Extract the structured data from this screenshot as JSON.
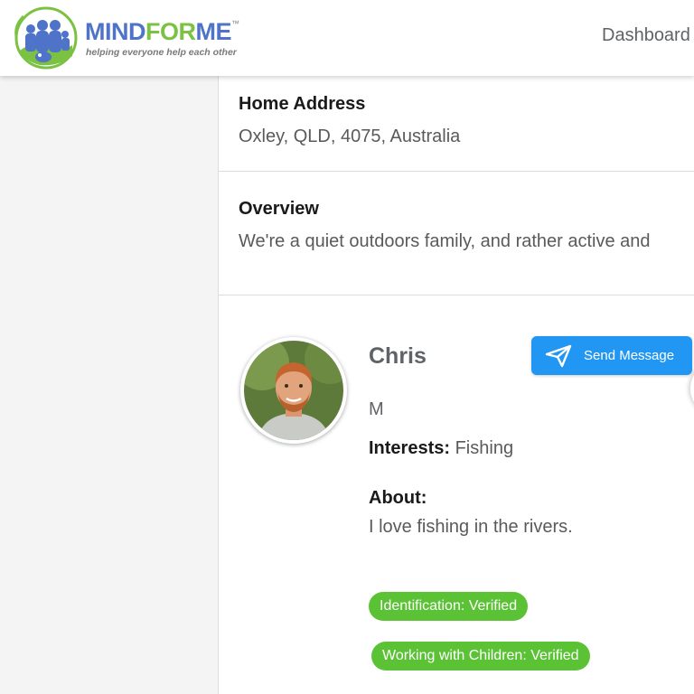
{
  "header": {
    "logo": {
      "word_mind": "MIND",
      "word_for": "FOR",
      "word_me": "ME",
      "trademark": "™",
      "tagline": "helping everyone help each other"
    },
    "nav": {
      "dashboard_label": "Dashboard"
    }
  },
  "home_address": {
    "title": "Home Address",
    "value": "Oxley, QLD, 4075, Australia"
  },
  "overview": {
    "title": "Overview",
    "text": "We're a quiet outdoors family, and rather active and"
  },
  "member": {
    "name": "Chris",
    "gender": "M",
    "interests_label": "Interests:",
    "interests_value": "Fishing",
    "about_label": "About:",
    "about_text": "I love fishing in the rivers.",
    "send_message_label": "Send Message",
    "badges": [
      {
        "label": "Identification: Verified"
      },
      {
        "label": "Working with Children: Verified"
      }
    ]
  },
  "colors": {
    "brand_blue": "#4f73c9",
    "brand_green": "#7cc242",
    "button_blue": "#2196f3",
    "badge_green": "#5bc236"
  },
  "icons": {
    "send": "paper-plane-icon",
    "avatar": "profile-photo"
  }
}
